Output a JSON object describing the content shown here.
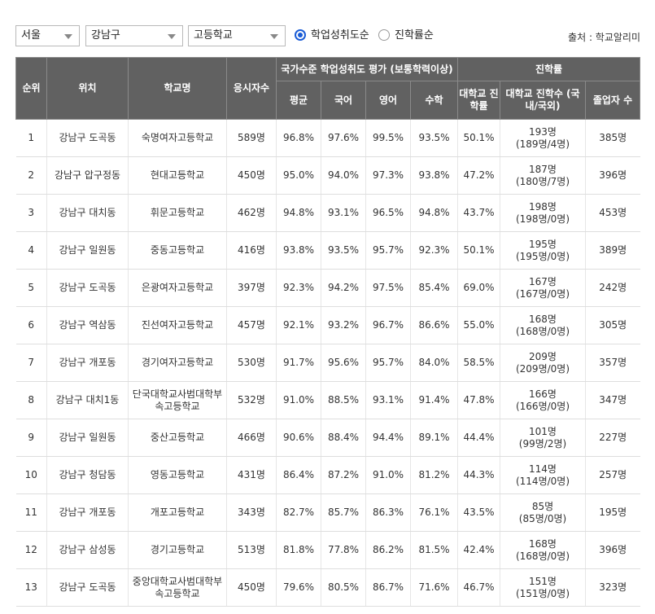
{
  "filters": {
    "region": "서울",
    "district": "강남구",
    "school_type": "고등학교"
  },
  "sort_options": [
    {
      "label": "학업성취도순",
      "checked": true
    },
    {
      "label": "진학률순",
      "checked": false
    }
  ],
  "source": "출처 : 학교알리미",
  "headers": {
    "rank": "순위",
    "location": "위치",
    "school": "학교명",
    "examinees": "응시자수",
    "achievement_group": "국가수준 학업성취도 평가 (보통학력이상)",
    "average": "평균",
    "korean": "국어",
    "english": "영어",
    "math": "수학",
    "admission_group": "진학률",
    "univ_rate": "대학교 진학률",
    "univ_count": "대학교 진학수 (국내/국외)",
    "graduates": "졸업자 수"
  },
  "rows": [
    {
      "rank": "1",
      "location": "강남구 도곡동",
      "school": "숙명여자고등학교",
      "examinees": "589명",
      "average": "96.8%",
      "korean": "97.6%",
      "english": "99.5%",
      "math": "93.5%",
      "univ_rate": "50.1%",
      "univ_total": "193명",
      "univ_split": "(189명/4명)",
      "graduates": "385명"
    },
    {
      "rank": "2",
      "location": "강남구 압구정동",
      "school": "현대고등학교",
      "examinees": "450명",
      "average": "95.0%",
      "korean": "94.0%",
      "english": "97.3%",
      "math": "93.8%",
      "univ_rate": "47.2%",
      "univ_total": "187명",
      "univ_split": "(180명/7명)",
      "graduates": "396명"
    },
    {
      "rank": "3",
      "location": "강남구 대치동",
      "school": "휘문고등학교",
      "examinees": "462명",
      "average": "94.8%",
      "korean": "93.1%",
      "english": "96.5%",
      "math": "94.8%",
      "univ_rate": "43.7%",
      "univ_total": "198명",
      "univ_split": "(198명/0명)",
      "graduates": "453명"
    },
    {
      "rank": "4",
      "location": "강남구 일원동",
      "school": "중동고등학교",
      "examinees": "416명",
      "average": "93.8%",
      "korean": "93.5%",
      "english": "95.7%",
      "math": "92.3%",
      "univ_rate": "50.1%",
      "univ_total": "195명",
      "univ_split": "(195명/0명)",
      "graduates": "389명"
    },
    {
      "rank": "5",
      "location": "강남구 도곡동",
      "school": "은광여자고등학교",
      "examinees": "397명",
      "average": "92.3%",
      "korean": "94.2%",
      "english": "97.5%",
      "math": "85.4%",
      "univ_rate": "69.0%",
      "univ_total": "167명",
      "univ_split": "(167명/0명)",
      "graduates": "242명"
    },
    {
      "rank": "6",
      "location": "강남구 역삼동",
      "school": "진선여자고등학교",
      "examinees": "457명",
      "average": "92.1%",
      "korean": "93.2%",
      "english": "96.7%",
      "math": "86.6%",
      "univ_rate": "55.0%",
      "univ_total": "168명",
      "univ_split": "(168명/0명)",
      "graduates": "305명"
    },
    {
      "rank": "7",
      "location": "강남구 개포동",
      "school": "경기여자고등학교",
      "examinees": "530명",
      "average": "91.7%",
      "korean": "95.6%",
      "english": "95.7%",
      "math": "84.0%",
      "univ_rate": "58.5%",
      "univ_total": "209명",
      "univ_split": "(209명/0명)",
      "graduates": "357명"
    },
    {
      "rank": "8",
      "location": "강남구 대치1동",
      "school": "단국대학교사범대학부속고등학교",
      "examinees": "532명",
      "average": "91.0%",
      "korean": "88.5%",
      "english": "93.1%",
      "math": "91.4%",
      "univ_rate": "47.8%",
      "univ_total": "166명",
      "univ_split": "(166명/0명)",
      "graduates": "347명"
    },
    {
      "rank": "9",
      "location": "강남구 일원동",
      "school": "중산고등학교",
      "examinees": "466명",
      "average": "90.6%",
      "korean": "88.4%",
      "english": "94.4%",
      "math": "89.1%",
      "univ_rate": "44.4%",
      "univ_total": "101명",
      "univ_split": "(99명/2명)",
      "graduates": "227명"
    },
    {
      "rank": "10",
      "location": "강남구 청담동",
      "school": "영동고등학교",
      "examinees": "431명",
      "average": "86.4%",
      "korean": "87.2%",
      "english": "91.0%",
      "math": "81.2%",
      "univ_rate": "44.3%",
      "univ_total": "114명",
      "univ_split": "(114명/0명)",
      "graduates": "257명"
    },
    {
      "rank": "11",
      "location": "강남구 개포동",
      "school": "개포고등학교",
      "examinees": "343명",
      "average": "82.7%",
      "korean": "85.7%",
      "english": "86.3%",
      "math": "76.1%",
      "univ_rate": "43.5%",
      "univ_total": "85명",
      "univ_split": "(85명/0명)",
      "graduates": "195명"
    },
    {
      "rank": "12",
      "location": "강남구 삼성동",
      "school": "경기고등학교",
      "examinees": "513명",
      "average": "81.8%",
      "korean": "77.8%",
      "english": "86.2%",
      "math": "81.5%",
      "univ_rate": "42.4%",
      "univ_total": "168명",
      "univ_split": "(168명/0명)",
      "graduates": "396명"
    },
    {
      "rank": "13",
      "location": "강남구 도곡동",
      "school": "중앙대학교사범대학부속고등학교",
      "examinees": "450명",
      "average": "79.6%",
      "korean": "80.5%",
      "english": "86.7%",
      "math": "71.6%",
      "univ_rate": "46.7%",
      "univ_total": "151명",
      "univ_split": "(151명/0명)",
      "graduates": "323명"
    }
  ]
}
